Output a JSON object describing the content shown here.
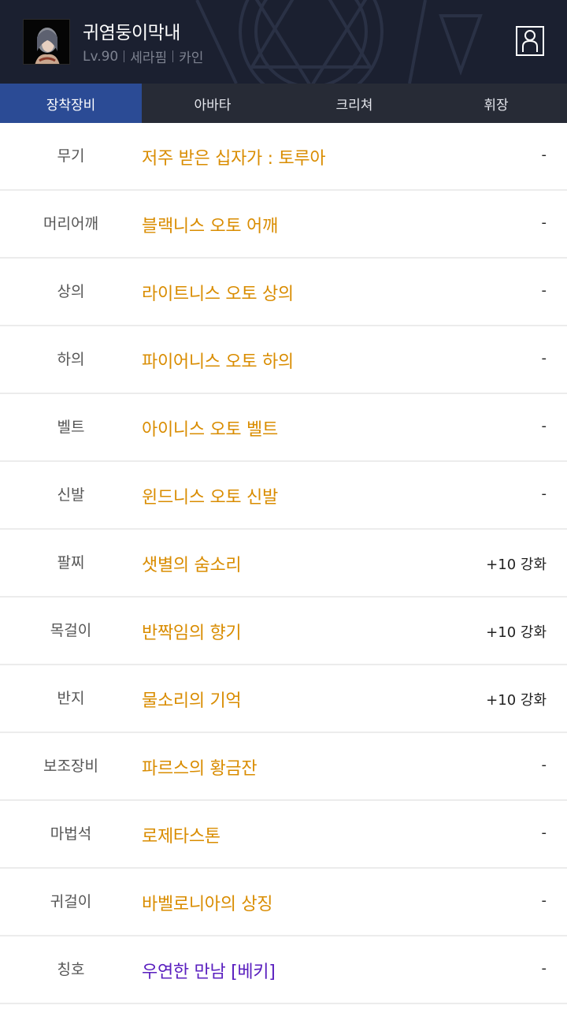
{
  "header": {
    "name": "귀염둥이막내",
    "level": "Lv.90",
    "class": "세라핌",
    "server": "카인"
  },
  "tabs": [
    {
      "label": "장착장비",
      "active": true
    },
    {
      "label": "아바타",
      "active": false
    },
    {
      "label": "크리쳐",
      "active": false
    },
    {
      "label": "휘장",
      "active": false
    }
  ],
  "equipment": [
    {
      "slot": "무기",
      "item": "저주 받은 십자가 : 토루아",
      "enhance": "-",
      "color": "#d98c00"
    },
    {
      "slot": "머리어깨",
      "item": "블랙니스 오토 어깨",
      "enhance": "-",
      "color": "#d98c00"
    },
    {
      "slot": "상의",
      "item": "라이트니스 오토 상의",
      "enhance": "-",
      "color": "#d98c00"
    },
    {
      "slot": "하의",
      "item": "파이어니스 오토 하의",
      "enhance": "-",
      "color": "#d98c00"
    },
    {
      "slot": "벨트",
      "item": "아이니스 오토 벨트",
      "enhance": "-",
      "color": "#d98c00"
    },
    {
      "slot": "신발",
      "item": "윈드니스 오토 신발",
      "enhance": "-",
      "color": "#d98c00"
    },
    {
      "slot": "팔찌",
      "item": "샛별의 숨소리",
      "enhance": "+10 강화",
      "color": "#d98c00"
    },
    {
      "slot": "목걸이",
      "item": "반짝임의 향기",
      "enhance": "+10 강화",
      "color": "#d98c00"
    },
    {
      "slot": "반지",
      "item": "물소리의 기억",
      "enhance": "+10 강화",
      "color": "#d98c00"
    },
    {
      "slot": "보조장비",
      "item": "파르스의 황금잔",
      "enhance": "-",
      "color": "#d98c00"
    },
    {
      "slot": "마법석",
      "item": "로제타스톤",
      "enhance": "-",
      "color": "#d98c00"
    },
    {
      "slot": "귀걸이",
      "item": "바벨로니아의 상징",
      "enhance": "-",
      "color": "#d98c00"
    },
    {
      "slot": "칭호",
      "item": "우연한 만남 [베키]",
      "enhance": "-",
      "color": "#5a1fbf"
    }
  ]
}
